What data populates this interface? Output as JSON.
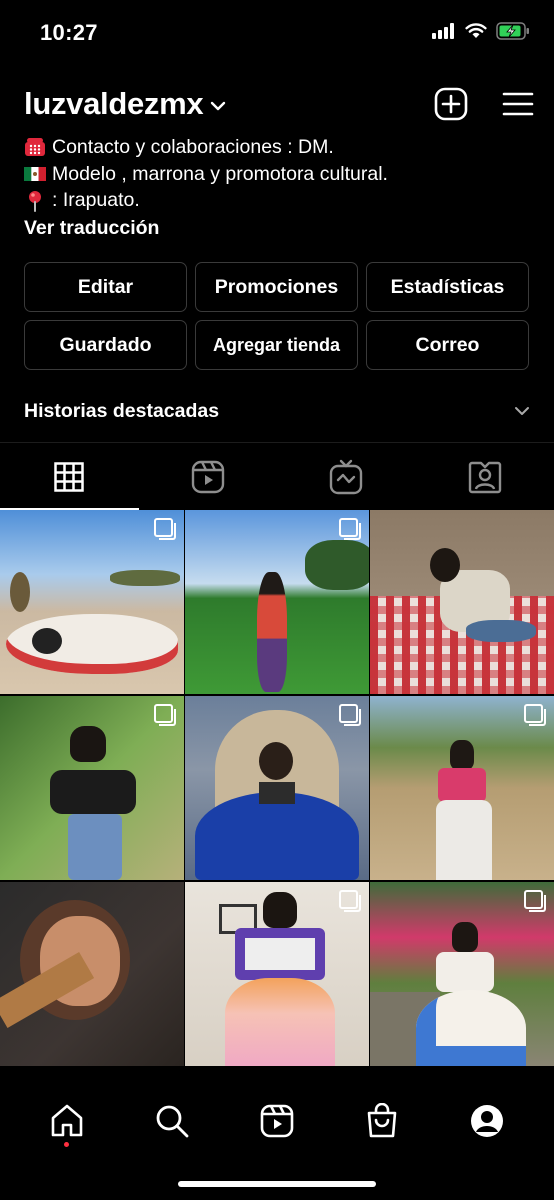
{
  "status_bar": {
    "time": "10:27",
    "icons": [
      "cellular-signal-icon",
      "wifi-icon",
      "battery-charging-icon"
    ]
  },
  "profile": {
    "username": "luzvaldezmx",
    "bio": [
      {
        "icon": "telephone-icon",
        "text": "Contacto y colaboraciones : DM."
      },
      {
        "icon": "mexico-flag-icon",
        "text": "Modelo , marrona y promotora cultural."
      },
      {
        "icon": "pin-icon",
        "text": ": Irapuato."
      }
    ],
    "translate_label": "Ver traducción"
  },
  "actions": {
    "edit": "Editar",
    "promotions": "Promociones",
    "stats": "Estadísticas",
    "saved": "Guardado",
    "add_shop": "Agregar tienda",
    "email": "Correo"
  },
  "highlights": {
    "label": "Historias destacadas"
  },
  "tabs": [
    "grid-icon",
    "reels-icon",
    "igtv-icon",
    "tagged-icon"
  ],
  "posts": [
    {
      "multi": true,
      "scene": "woman in white embroidered dress lying on desert ground, blue sky"
    },
    {
      "multi": true,
      "scene": "woman standing in green wheat field"
    },
    {
      "multi": false,
      "scene": "woman sitting on red checkered couch, stone wall"
    },
    {
      "multi": true,
      "scene": "woman in black embroidered top among palms"
    },
    {
      "multi": true,
      "scene": "woman in blue full skirt in arched doorway"
    },
    {
      "multi": true,
      "scene": "woman in white skirt in dry field"
    },
    {
      "multi": false,
      "scene": "close-up portrait of woman leaning on railing"
    },
    {
      "multi": true,
      "scene": "woman in embroidered blouse in room"
    },
    {
      "multi": true,
      "scene": "woman with bougainvillea and embroidered skirt"
    }
  ],
  "bottom_nav": [
    "home-icon",
    "search-icon",
    "reels-icon",
    "shop-icon",
    "profile-icon"
  ],
  "colors": {
    "background": "#000000",
    "button_border": "#3a3a3a",
    "text": "#ffffff",
    "notification_dot": "#ff3040",
    "battery": "#31d158"
  }
}
